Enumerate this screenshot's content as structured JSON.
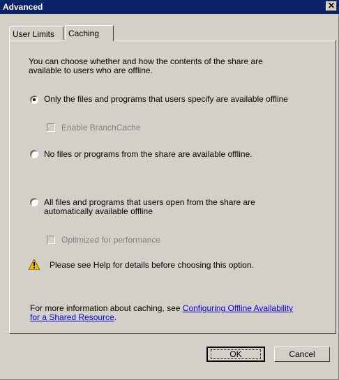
{
  "window": {
    "title": "Advanced",
    "close_icon": "close-icon"
  },
  "tabs": [
    {
      "label": "User Limits"
    },
    {
      "label": "Caching"
    }
  ],
  "intro": "You can choose whether and how the contents of the share are available to users who are offline.",
  "options": [
    {
      "label": "Only the files and programs that users specify are available offline",
      "checked": true
    },
    {
      "label": "No files or programs from the share are available offline.",
      "checked": false
    },
    {
      "label": "All files and programs that users open from the share are automatically available offline",
      "checked": false
    }
  ],
  "sub_options": {
    "branchcache": "Enable BranchCache",
    "optimized": "Optimized for performance"
  },
  "warning": "Please see Help for details before choosing this option.",
  "info": {
    "prefix": "For more information about caching, see ",
    "link": "Configuring Offline Availability for a Shared Resource",
    "suffix": "."
  },
  "buttons": {
    "ok": "OK",
    "cancel": "Cancel"
  }
}
